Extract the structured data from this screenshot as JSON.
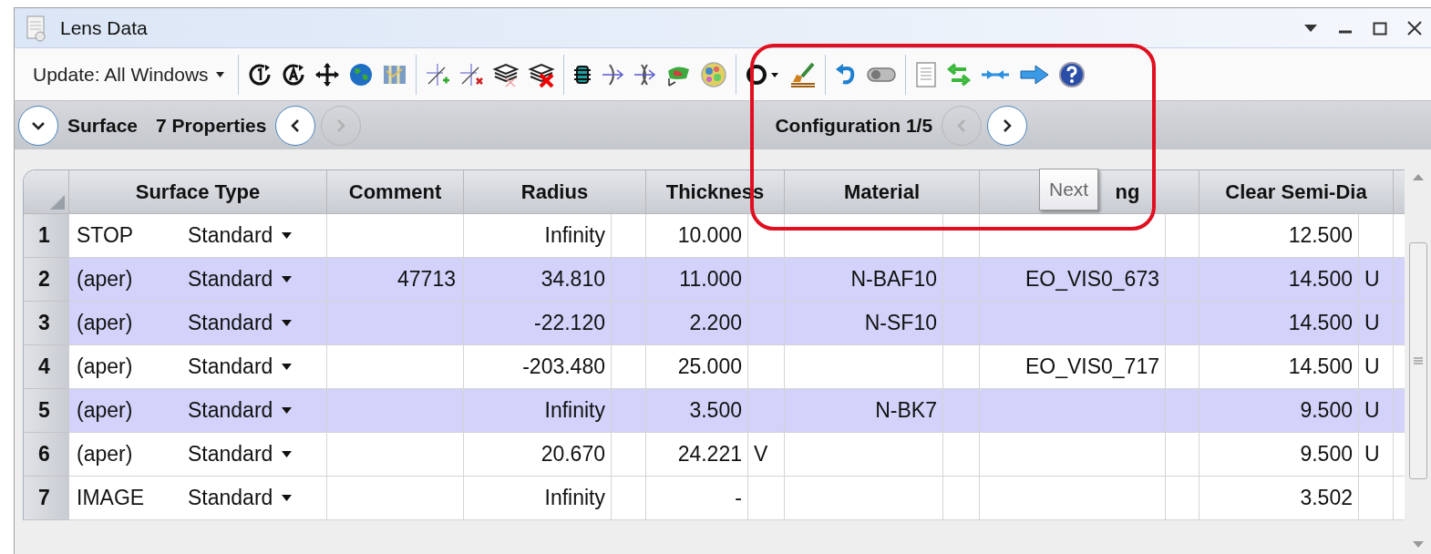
{
  "window": {
    "title": "Lens Data"
  },
  "toolbar": {
    "update_dropdown": "Update: All Windows"
  },
  "nav": {
    "section": "Surface",
    "properties": "7 Properties",
    "surface_prev_disabled": false,
    "surface_next_disabled": true,
    "configuration": "Configuration 1/5",
    "config_prev_disabled": true,
    "config_next_disabled": false
  },
  "tooltip": "Next",
  "table": {
    "columns": [
      "Surface Type",
      "Comment",
      "Radius",
      "Thickness",
      "Material",
      "ng",
      "Clear Semi-Dia"
    ],
    "rows": [
      {
        "number": "1",
        "name": "STOP",
        "type": "Standard",
        "radius": "Infinity",
        "thickness": "10.000",
        "semi_dia": "12.500",
        "highlighted": false
      },
      {
        "number": "2",
        "name": "(aper)",
        "type": "Standard",
        "comment": "47713",
        "radius": "34.810",
        "thickness": "11.000",
        "material": "N-BAF10",
        "coating": "EO_VIS0_673",
        "semi_dia": "14.500",
        "semi_dia_solve": "U",
        "highlighted": true
      },
      {
        "number": "3",
        "name": "(aper)",
        "type": "Standard",
        "radius": "-22.120",
        "thickness": "2.200",
        "material": "N-SF10",
        "semi_dia": "14.500",
        "semi_dia_solve": "U",
        "highlighted": true
      },
      {
        "number": "4",
        "name": "(aper)",
        "type": "Standard",
        "radius": "-203.480",
        "thickness": "25.000",
        "coating": "EO_VIS0_717",
        "semi_dia": "14.500",
        "semi_dia_solve": "U",
        "highlighted": false
      },
      {
        "number": "5",
        "name": "(aper)",
        "type": "Standard",
        "radius": "Infinity",
        "thickness": "3.500",
        "material": "N-BK7",
        "semi_dia": "9.500",
        "semi_dia_solve": "U",
        "highlighted": true
      },
      {
        "number": "6",
        "name": "(aper)",
        "type": "Standard",
        "radius": "20.670",
        "thickness": "24.221",
        "thickness_solve": "V",
        "semi_dia": "9.500",
        "semi_dia_solve": "U",
        "highlighted": false
      },
      {
        "number": "7",
        "name": "IMAGE",
        "type": "Standard",
        "radius": "Infinity",
        "thickness": "-",
        "semi_dia": "3.502",
        "highlighted": false
      }
    ]
  }
}
